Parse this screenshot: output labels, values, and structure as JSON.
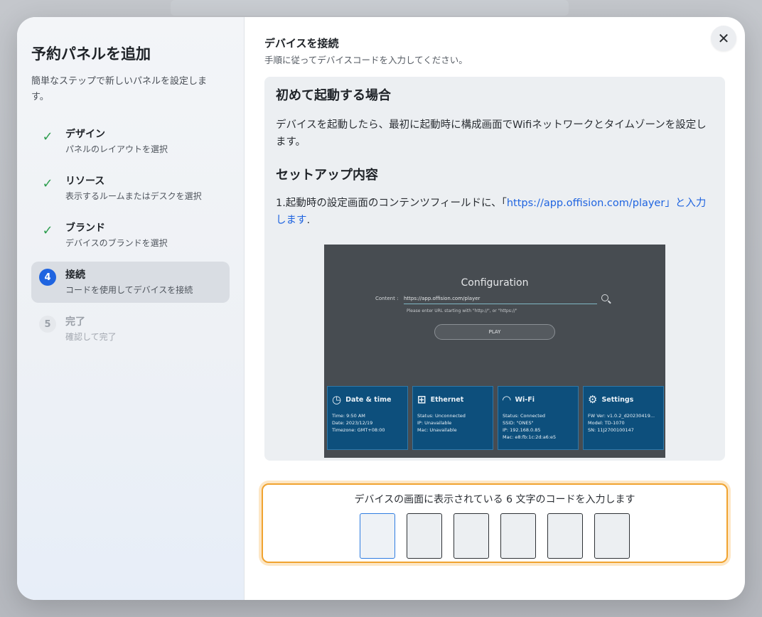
{
  "sidebar": {
    "title": "予約パネルを追加",
    "subtitle": "簡単なステップで新しいパネルを設定します。",
    "steps": [
      {
        "title": "デザイン",
        "desc": "パネルのレイアウトを選択",
        "status": "done"
      },
      {
        "title": "リソース",
        "desc": "表示するルームまたはデスクを選択",
        "status": "done"
      },
      {
        "title": "ブランド",
        "desc": "デバイスのブランドを選択",
        "status": "done"
      },
      {
        "title": "接続",
        "desc": "コードを使用してデバイスを接続",
        "status": "active",
        "number": "4"
      },
      {
        "title": "完了",
        "desc": "確認して完了",
        "status": "pending",
        "number": "5"
      }
    ]
  },
  "main": {
    "title": "デバイスを接続",
    "hint": "手順に従ってデバイスコードを入力してください。",
    "close_icon": "✕",
    "first_boot": {
      "heading": "初めて起動する場合",
      "text": "デバイスを起動したら、最初に起動時に構成画面でWifiネットワークとタイムゾーンを設定します。"
    },
    "setup": {
      "heading": "セットアップ内容",
      "text_before": "1.起動時の設定画面のコンテンツフィールドに、「",
      "link": "https://app.offision.com/player」と入力します",
      "text_after": "."
    },
    "device_screen": {
      "title": "Configuration",
      "content_label": "Content :",
      "content_value": "https://app.offision.com/player",
      "url_hint": "Please enter URL starting with \"http://\", or \"https://\"",
      "play_label": "PLAY",
      "tiles": [
        {
          "title": "Date & time",
          "icon": "clock-icon",
          "lines": [
            "Time: 9:50 AM",
            "Date: 2023/12/19",
            "Timezone: GMT+08:00"
          ]
        },
        {
          "title": "Ethernet",
          "icon": "ethernet-icon",
          "lines": [
            "Status: Unconnected",
            "IP: Unavailable",
            "Mac: Unavailable"
          ]
        },
        {
          "title": "Wi-Fi",
          "icon": "wifi-icon",
          "lines": [
            "Status: Connected",
            "SSID: \"ONES\"",
            "IP: 192.168.0.85",
            "Mac: e8:fb:1c:2d:a6:e5"
          ]
        },
        {
          "title": "Settings",
          "icon": "gear-icon",
          "lines": [
            "FW Ver: v1.0.2_d20230419...",
            "Model: TD-1070",
            "SN: 11J2700100147"
          ]
        }
      ]
    },
    "code_entry": {
      "prompt": "デバイスの画面に表示されている 6 文字のコードを入力します",
      "cells": [
        "",
        "",
        "",
        "",
        "",
        ""
      ]
    }
  },
  "colors": {
    "accent": "#1f64e0",
    "check": "#2e9e4f",
    "code_border": "#f0a330",
    "tile_bg": "#0d4f7c"
  }
}
